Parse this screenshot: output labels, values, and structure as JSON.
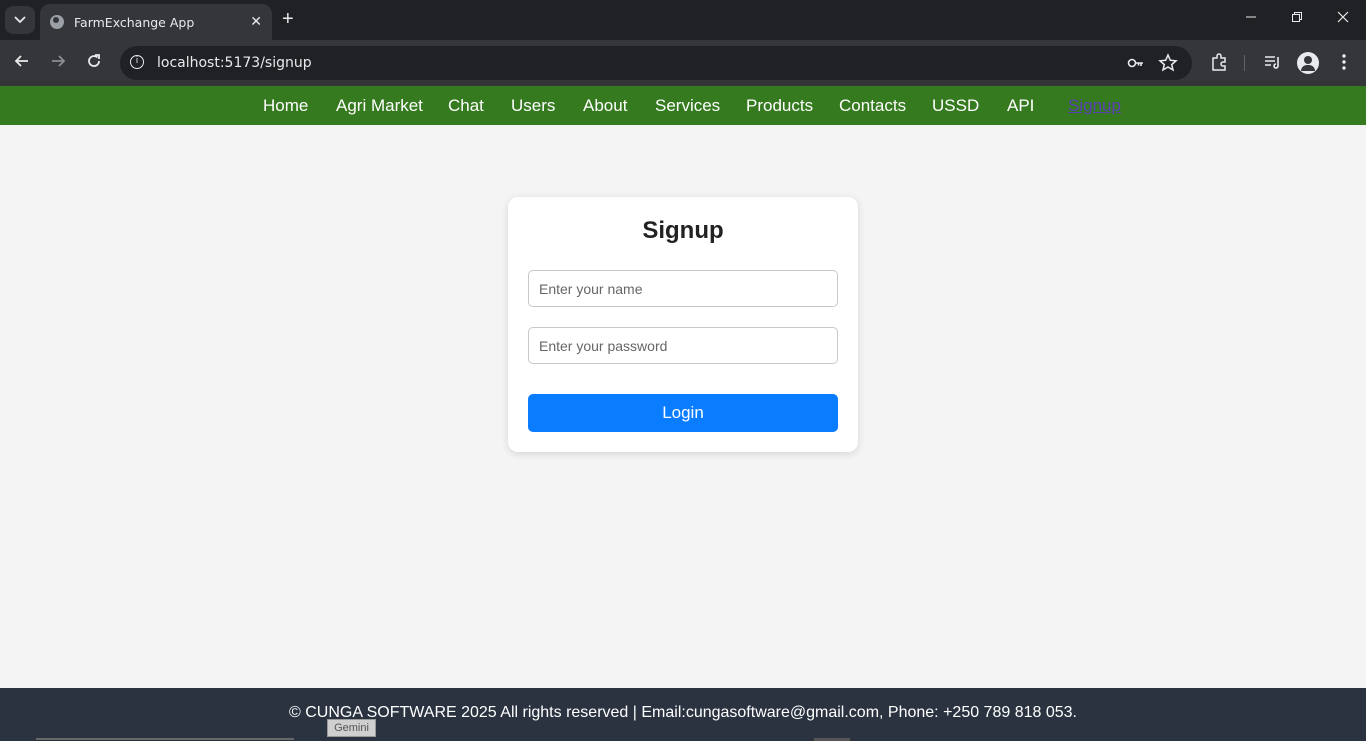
{
  "browser": {
    "tab_title": "FarmExchange App",
    "tab_close": "✕",
    "new_tab": "+",
    "url": "localhost:5173/signup",
    "icons": [
      "tab-search-icon",
      "back-icon",
      "forward-icon",
      "reload-icon",
      "site-info-icon",
      "password-key-icon",
      "bookmark-star-icon",
      "extensions-icon",
      "media-icon",
      "profile-icon",
      "menu-icon"
    ]
  },
  "nav": {
    "items": [
      "Home",
      "Agri Market",
      "Chat",
      "Users",
      "About",
      "Services",
      "Products",
      "Contacts",
      "USSD",
      "API",
      "Signup"
    ],
    "active": "Signup",
    "background": "#357a1f"
  },
  "signup": {
    "title": "Signup",
    "name_placeholder": "Enter your name",
    "password_placeholder": "Enter your password",
    "submit_label": "Login",
    "button_color": "#0a7cff"
  },
  "footer": {
    "text": "© CUNGA SOFTWARE 2025 All rights reserved | Email:cungasoftware@gmail.com, Phone: +250 789 818 053."
  },
  "tooltip": {
    "label": "Gemini"
  }
}
